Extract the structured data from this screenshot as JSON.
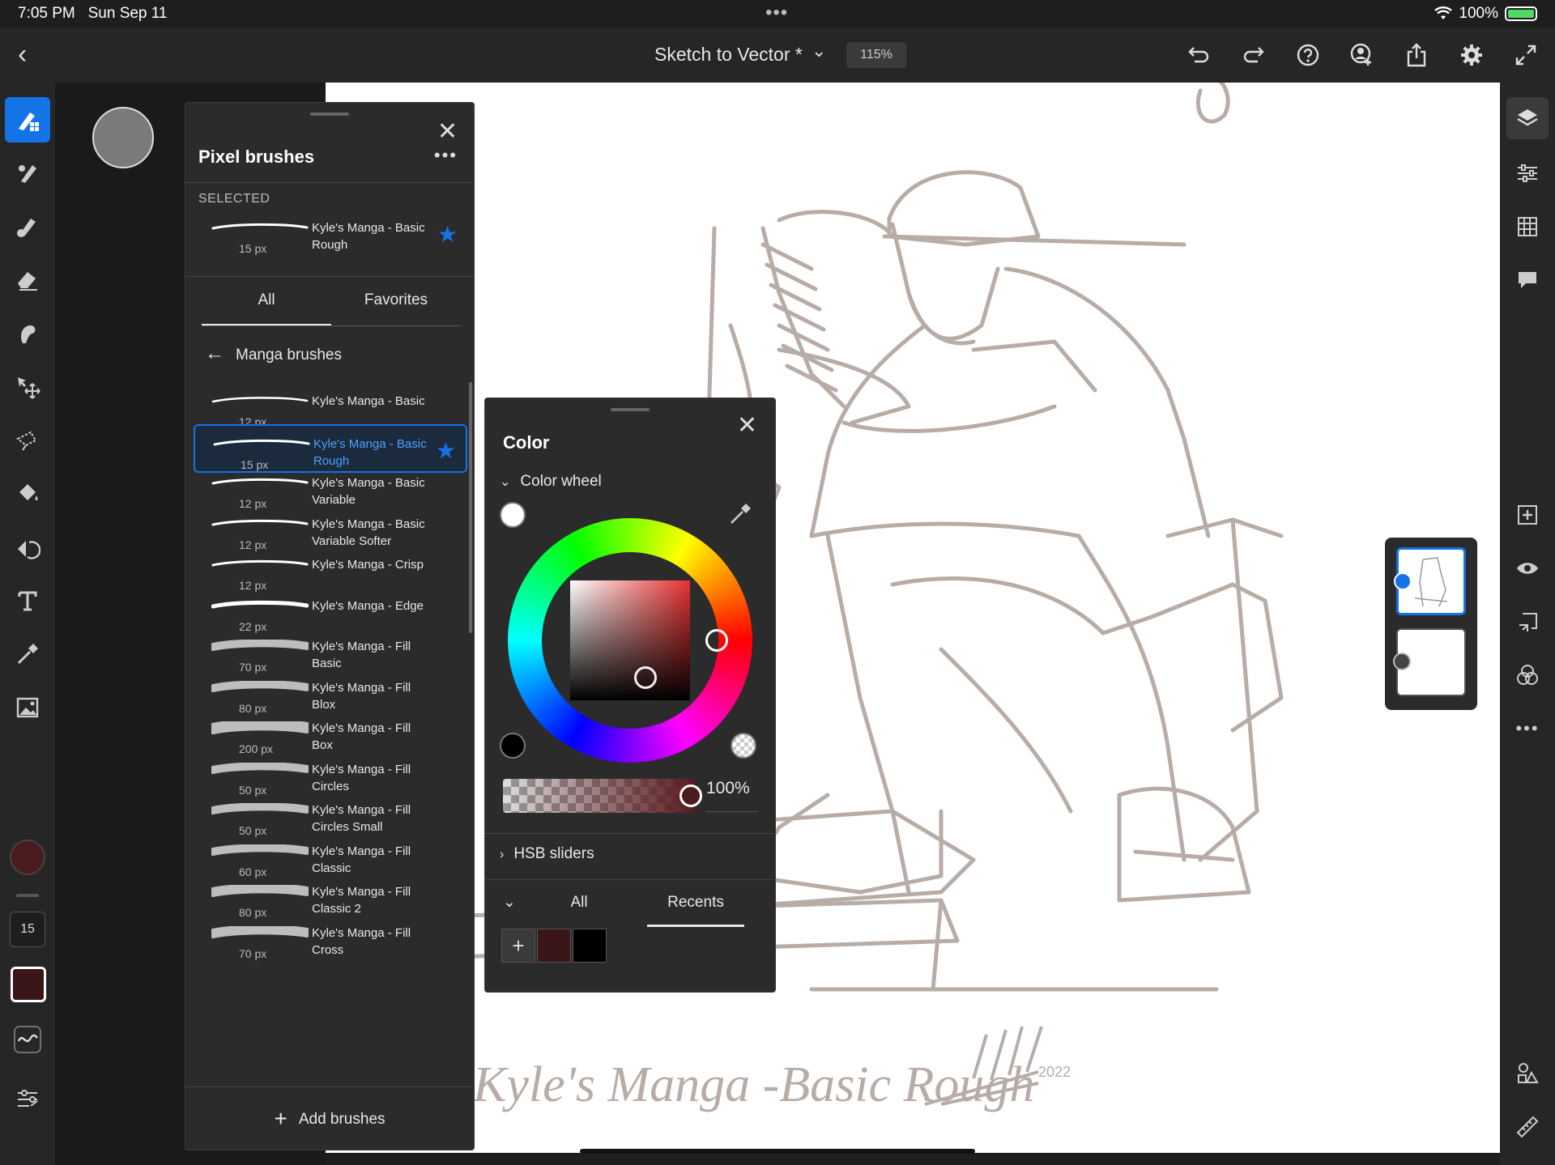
{
  "status": {
    "time": "7:05 PM",
    "date": "Sun Sep 11",
    "battery": "100%"
  },
  "topbar": {
    "title": "Sketch to Vector *",
    "zoom": "115%"
  },
  "left_tools": {
    "brush_size": "15",
    "active_color": "#3a1618"
  },
  "brush_panel": {
    "title": "Pixel brushes",
    "selected_label": "SELECTED",
    "selected": {
      "name": "Kyle's Manga - Basic Rough",
      "size": "15 px"
    },
    "tabs": [
      "All",
      "Favorites"
    ],
    "breadcrumb": "Manga brushes",
    "brushes": [
      {
        "name": "Kyle's Manga - Basic",
        "size": "12 px"
      },
      {
        "name": "Kyle's Manga - Basic Rough",
        "size": "15 px",
        "selected": true
      },
      {
        "name": "Kyle's Manga - Basic Variable",
        "size": "12 px"
      },
      {
        "name": "Kyle's Manga - Basic Variable Softer",
        "size": "12 px"
      },
      {
        "name": "Kyle's Manga - Crisp",
        "size": "12 px"
      },
      {
        "name": "Kyle's Manga - Edge",
        "size": "22 px"
      },
      {
        "name": "Kyle's Manga - Fill Basic",
        "size": "70 px"
      },
      {
        "name": "Kyle's Manga - Fill Blox",
        "size": "80 px"
      },
      {
        "name": "Kyle's Manga - Fill Box",
        "size": "200 px"
      },
      {
        "name": "Kyle's Manga - Fill Circles",
        "size": "50 px"
      },
      {
        "name": "Kyle's Manga - Fill Circles Small",
        "size": "50 px"
      },
      {
        "name": "Kyle's Manga - Fill Classic",
        "size": "60 px"
      },
      {
        "name": "Kyle's Manga - Fill Classic 2",
        "size": "80 px"
      },
      {
        "name": "Kyle's Manga - Fill Cross",
        "size": "70 px"
      }
    ],
    "add_label": "Add brushes"
  },
  "color_panel": {
    "title": "Color",
    "wheel_label": "Color wheel",
    "opacity": "100%",
    "hsb_label": "HSB sliders",
    "tabs": [
      "All",
      "Recents"
    ],
    "active_tab": "Recents",
    "recents": [
      "#3a1618",
      "#000000"
    ]
  },
  "canvas": {
    "signature_text": "Kyle's Manga -Basic Rough",
    "year": "2022"
  }
}
